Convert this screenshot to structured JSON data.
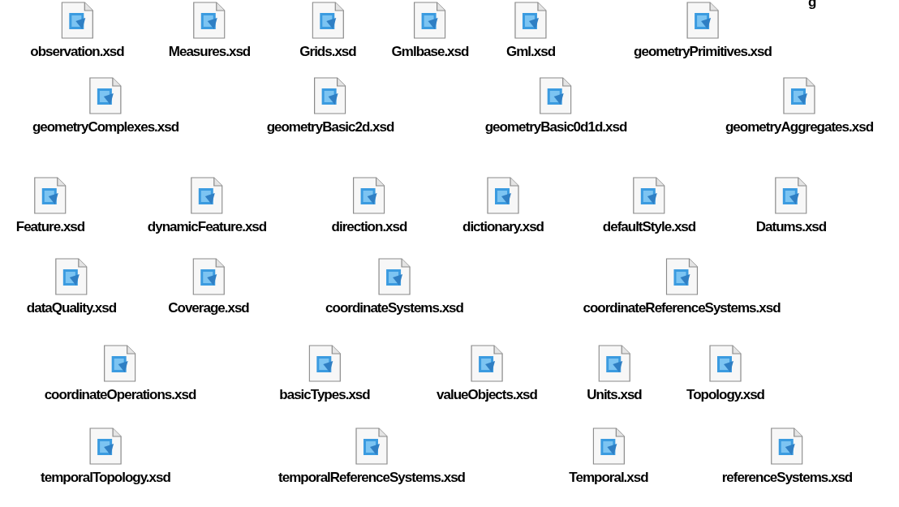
{
  "cut_off_label": "g",
  "rows": [
    {
      "files": [
        "observation.xsd",
        "Measures.xsd",
        "Grids.xsd",
        "Gmlbase.xsd",
        "Gml.xsd",
        "geometryPrimitives.xsd"
      ]
    },
    {
      "files": [
        "geometryComplexes.xsd",
        "geometryBasic2d.xsd",
        "geometryBasic0d1d.xsd",
        "geometryAggregates.xsd"
      ]
    },
    {
      "files": [
        "Feature.xsd",
        "dynamicFeature.xsd",
        "direction.xsd",
        "dictionary.xsd",
        "defaultStyle.xsd",
        "Datums.xsd"
      ]
    },
    {
      "files": [
        "dataQuality.xsd",
        "Coverage.xsd",
        "coordinateSystems.xsd",
        "coordinateReferenceSystems.xsd"
      ]
    },
    {
      "files": [
        "coordinateOperations.xsd",
        "basicTypes.xsd",
        "valueObjects.xsd",
        "Units.xsd",
        "Topology.xsd"
      ]
    },
    {
      "files": [
        "temporalTopology.xsd",
        "temporalReferenceSystems.xsd",
        "Temporal.xsd",
        "referenceSystems.xsd"
      ]
    }
  ]
}
